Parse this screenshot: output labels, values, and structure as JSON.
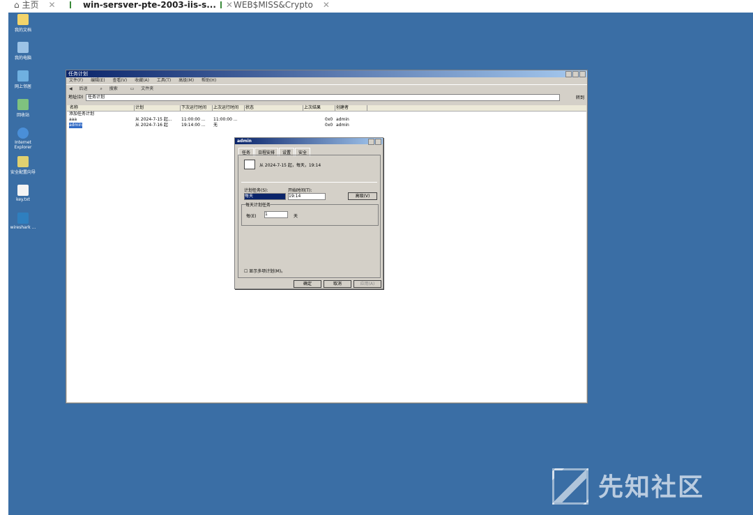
{
  "vm_tabs": [
    {
      "label": "主页"
    },
    {
      "label": "win-sersver-pte-2003-iis-s..."
    },
    {
      "label": "WEB$MISS&Crypto"
    }
  ],
  "desktop_icons": [
    {
      "label": "我的文档",
      "icon": "folder-icon"
    },
    {
      "label": "我的电脑",
      "icon": "computer-icon"
    },
    {
      "label": "网上邻居",
      "icon": "network-icon"
    },
    {
      "label": "回收站",
      "icon": "recycle-bin-icon"
    },
    {
      "label": "Internet Explorer",
      "icon": "ie-icon"
    },
    {
      "label": "安全配置向导",
      "icon": "security-wizard-icon"
    },
    {
      "label": "key.txt",
      "icon": "text-file-icon"
    },
    {
      "label": "wireshark ...",
      "icon": "wireshark-icon"
    }
  ],
  "window": {
    "title": "任务计划",
    "menu": [
      "文件(F)",
      "编辑(E)",
      "查看(V)",
      "收藏(A)",
      "工具(T)",
      "高级(M)",
      "帮助(H)"
    ],
    "toolbar": [
      "后退",
      "搜索",
      "文件夹"
    ],
    "address_label": "地址(D)",
    "address_value": "任务计划",
    "go_label": "转到",
    "columns": [
      "名称",
      "计划",
      "下次运行时间",
      "上次运行时间",
      "状态",
      "上次结果",
      "创建者"
    ],
    "rows": [
      {
        "name": "添加任务计划",
        "plan": "",
        "next": "",
        "last": "",
        "status": "",
        "result": "",
        "creator": ""
      },
      {
        "name": "aaa",
        "plan": "从 2024-7-15 起...",
        "next": "11:00:00 ...",
        "last": "11:00:00 ...",
        "status": "",
        "result": "0x0",
        "creator": "admin"
      },
      {
        "name": "admin",
        "plan": "从 2024-7-16 起",
        "next": "19:14:00 ...",
        "last": "无",
        "status": "",
        "result": "0x0",
        "creator": "admin"
      }
    ]
  },
  "dialog": {
    "title": "admin",
    "tabs": [
      "任务",
      "日程安排",
      "设置",
      "安全"
    ],
    "summary": "从 2024-7-15 起，每天，19:14",
    "schedule_label": "计划任务(S):",
    "schedule_value": "每天",
    "start_time_label": "开始时间(T):",
    "start_time_value": "19:14",
    "advanced_button": "高级(V)",
    "group_label": "每天计划任务",
    "every_label": "每(E)",
    "every_value": "1",
    "day_unit": "天",
    "multi_schedule_label": "显示多项计划(M)。",
    "ok": "确定",
    "cancel": "取消",
    "apply": "应用(A)"
  },
  "watermark": "先知社区"
}
